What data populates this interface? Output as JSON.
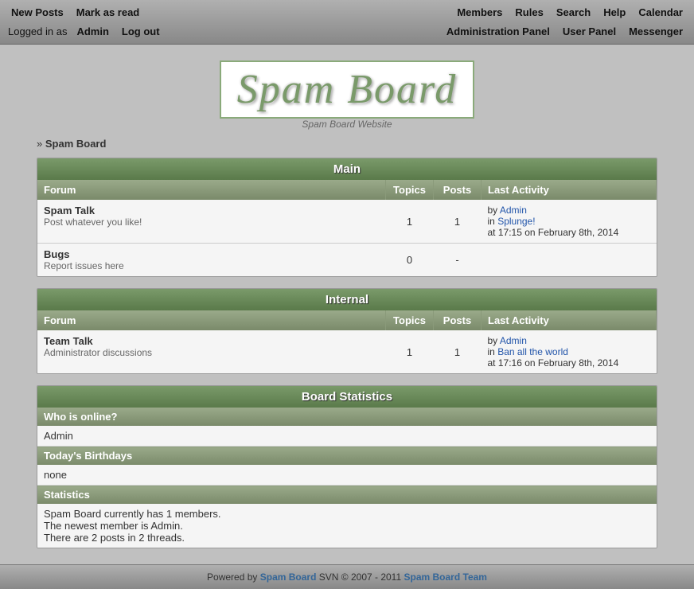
{
  "topnav": {
    "left_row1": [
      {
        "label": "New Posts",
        "name": "new-posts"
      },
      {
        "label": "Mark as read",
        "name": "mark-as-read"
      }
    ],
    "left_row2": {
      "logged_in_text": "Logged in as",
      "username": "Admin",
      "logout_label": "Log out"
    },
    "right_row1": [
      {
        "label": "Members",
        "name": "members-link"
      },
      {
        "label": "Rules",
        "name": "rules-link"
      },
      {
        "label": "Search",
        "name": "search-link"
      },
      {
        "label": "Help",
        "name": "help-link"
      },
      {
        "label": "Calendar",
        "name": "calendar-link"
      }
    ],
    "right_row2": [
      {
        "label": "Administration Panel",
        "name": "admin-panel-link"
      },
      {
        "label": "User Panel",
        "name": "user-panel-link"
      },
      {
        "label": "Messenger",
        "name": "messenger-link"
      }
    ]
  },
  "logo": {
    "title": "Spam Board",
    "subtitle": "Spam Board Website"
  },
  "breadcrumb": {
    "prefix": "»",
    "label": "Spam Board"
  },
  "sections": [
    {
      "name": "main-section",
      "header": "Main",
      "columns": [
        "Forum",
        "Topics",
        "Posts",
        "Last Activity"
      ],
      "forums": [
        {
          "name": "Spam Talk",
          "description": "Post whatever you like!",
          "topics": "1",
          "posts": "1",
          "last_activity": "by Admin\nin Splunge!\nat 17:15 on February 8th, 2014"
        },
        {
          "name": "Bugs",
          "description": "Report issues here",
          "topics": "0",
          "posts": "-",
          "last_activity": ""
        }
      ]
    },
    {
      "name": "internal-section",
      "header": "Internal",
      "columns": [
        "Forum",
        "Topics",
        "Posts",
        "Last Activity"
      ],
      "forums": [
        {
          "name": "Team Talk",
          "description": "Administrator discussions",
          "topics": "1",
          "posts": "1",
          "last_activity": "by Admin\nin Ban all the world\nat 17:16 on February 8th, 2014"
        }
      ]
    }
  ],
  "board_stats": {
    "header": "Board Statistics",
    "online_label": "Who is online?",
    "online_users": "Admin",
    "birthdays_label": "Today's Birthdays",
    "birthdays_value": "none",
    "statistics_label": "Statistics",
    "statistics_lines": [
      "Spam Board currently has 1 members.",
      "The newest member is Admin.",
      "There are 2 posts in 2 threads."
    ]
  },
  "footer": {
    "powered_by": "Powered by",
    "app_name": "Spam Board",
    "svn_text": "SVN © 2007 - 2011",
    "team_name": "Spam Board Team"
  }
}
